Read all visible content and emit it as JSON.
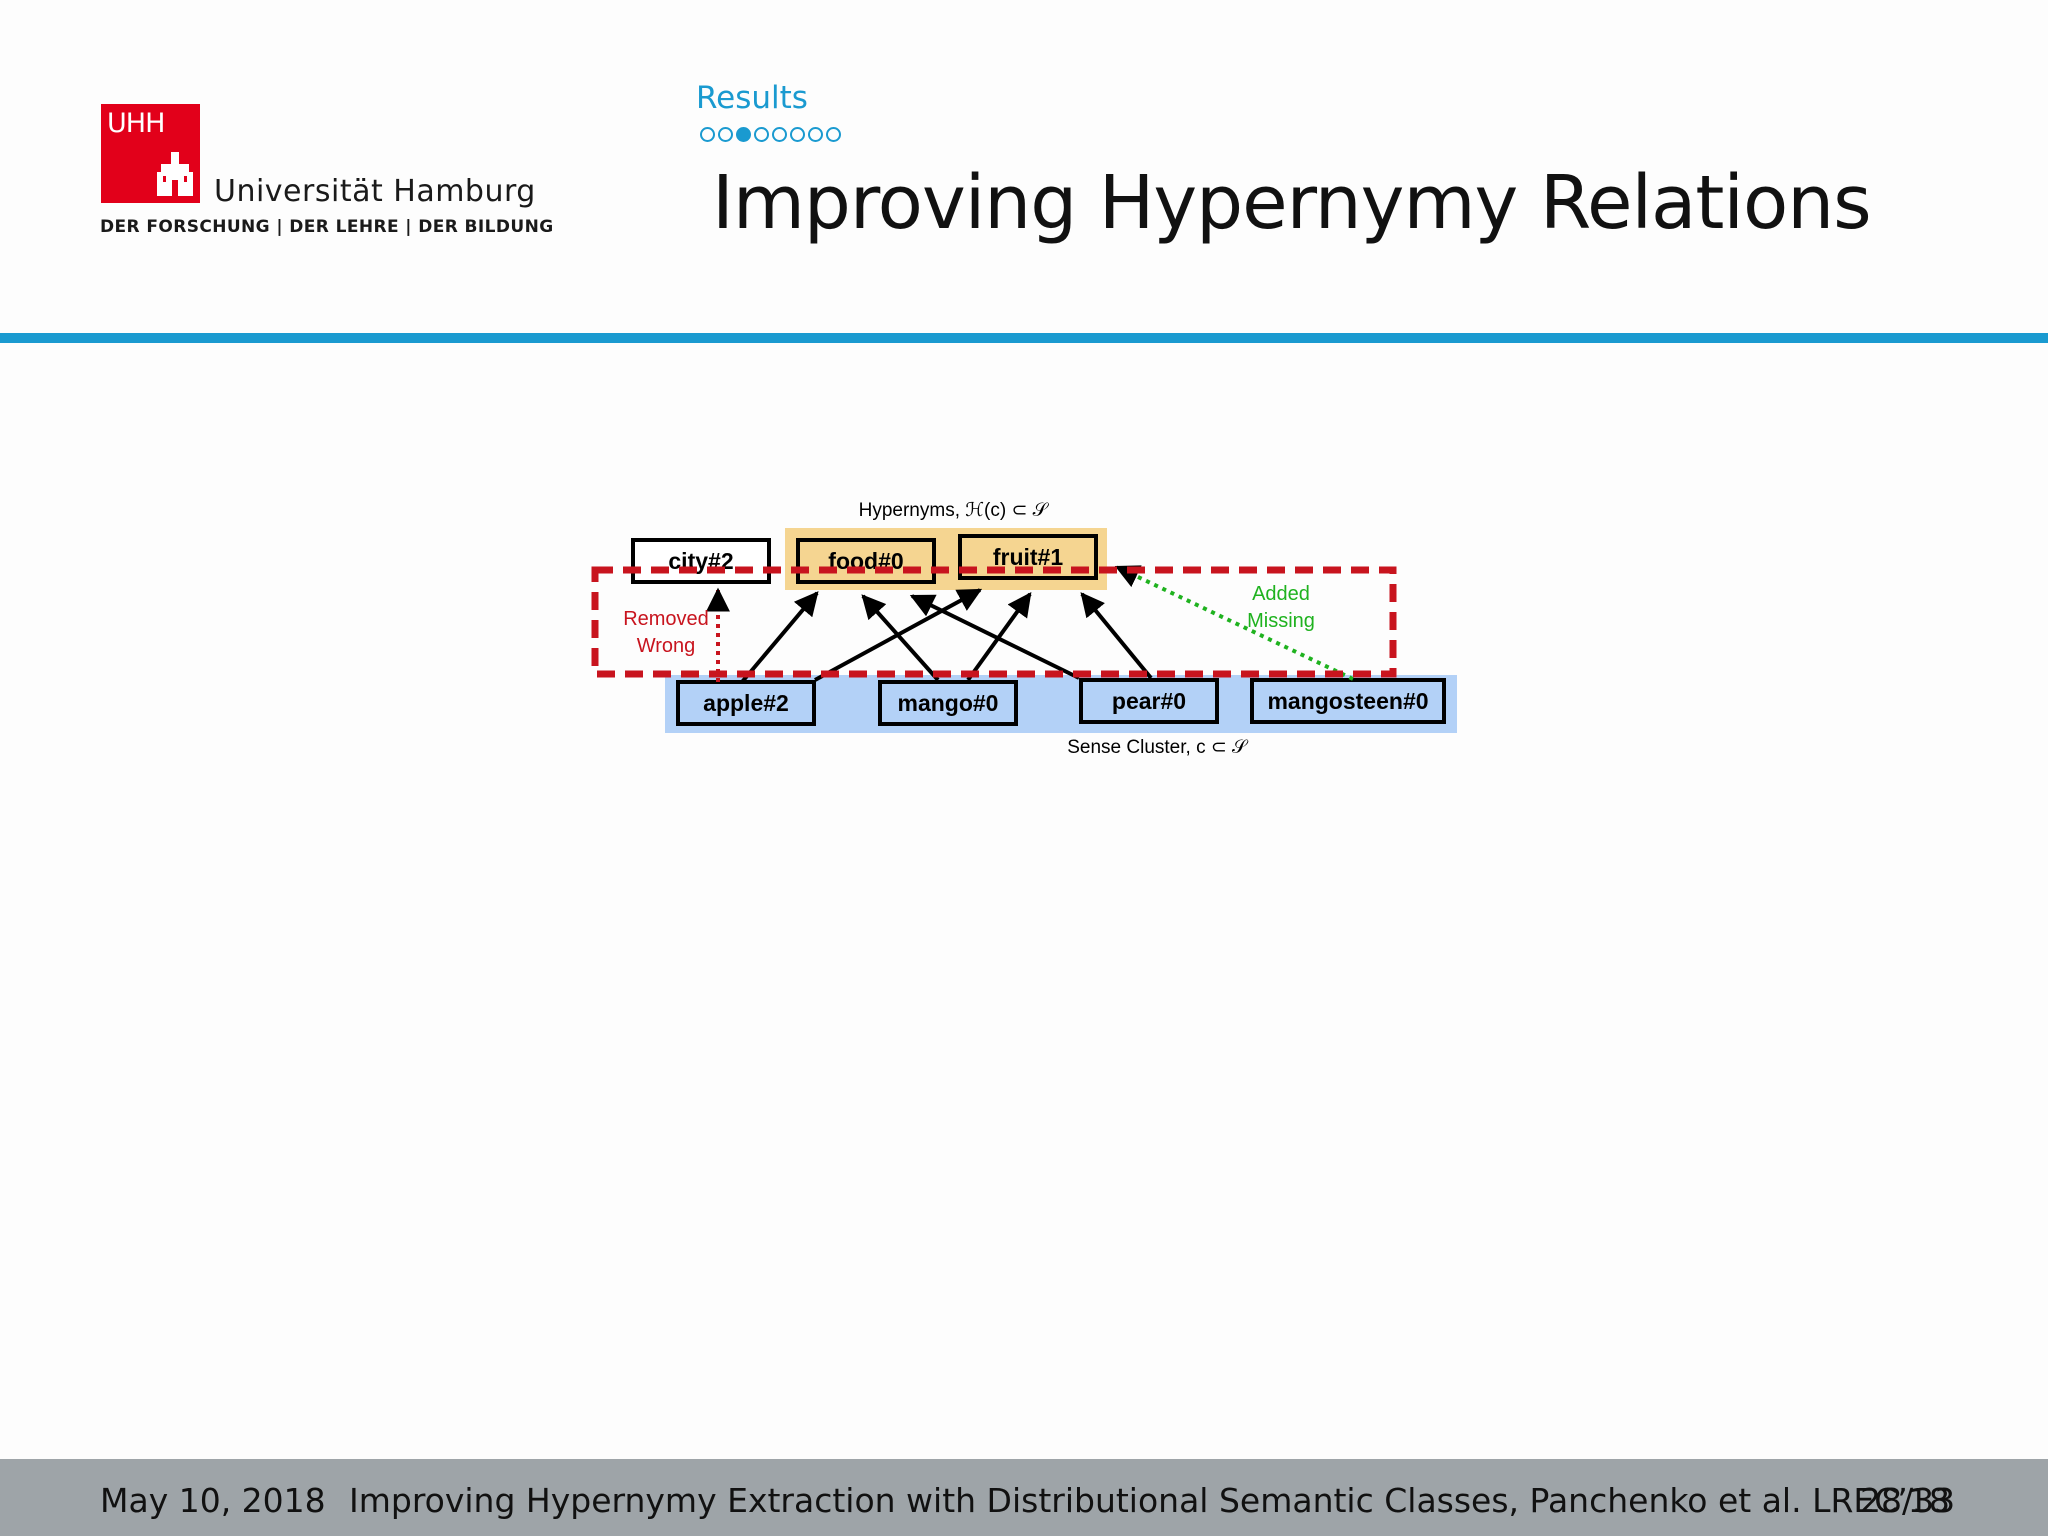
{
  "header": {
    "logo": {
      "mark": "UHH",
      "icon": "hamburg-tower-icon"
    },
    "university": "Universität Hamburg",
    "tagline": "DER FORSCHUNG | DER LEHRE | DER BILDUNG",
    "section": "Results",
    "progress": {
      "total": 8,
      "current": 3
    },
    "title": "Improving Hypernymy Relations"
  },
  "figure": {
    "hypernyms_label": "Hypernyms, ℋ(c) ⊂ 𝒮",
    "cluster_label": "Sense Cluster, c ⊂ 𝒮",
    "removed_label": [
      "Removed",
      "Wrong"
    ],
    "added_label": [
      "Added",
      "Missing"
    ],
    "nodes": {
      "city": "city#2",
      "food": "food#0",
      "fruit": "fruit#1",
      "apple": "apple#2",
      "mango": "mango#0",
      "pear": "pear#0",
      "mangosteen": "mangosteen#0"
    },
    "colors": {
      "hypernym_bg": "#f5d591",
      "cluster_bg": "#b3d1f7",
      "removed": "#c8141e",
      "added": "#1fb21f"
    }
  },
  "footer": {
    "date": "May 10, 2018",
    "talk": "Improving Hypernymy Extraction with Distributional Semantic Classes, Panchenko et al. LREC’18",
    "page": "28/33"
  }
}
